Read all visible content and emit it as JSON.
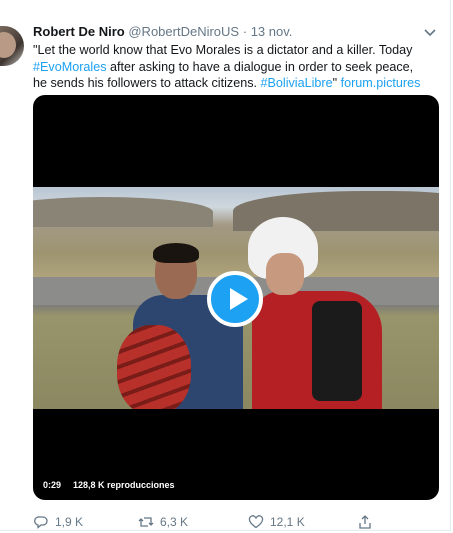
{
  "tweet": {
    "author_name": "Robert De Niro",
    "author_handle": "@RobertDeNiroUS",
    "separator": "·",
    "date": "13 nov.",
    "text_part1": "\"Let the world know that Evo Morales is a dictator and a killer. Today ",
    "hashtag1": "#EvoMorales",
    "text_part2": " after asking to have a dialogue in order to seek peace, he sends his followers to attack citizens. ",
    "hashtag2": "#BoliviaLibre",
    "text_part3": "\" ",
    "link": "forum.pictures"
  },
  "video": {
    "duration": "0:29",
    "views": "128,8 K reproducciones"
  },
  "actions": {
    "reply_count": "1,9 K",
    "retweet_count": "6,3 K",
    "like_count": "12,1 K"
  },
  "colors": {
    "accent": "#1da1f2",
    "secondary_text": "#657786"
  },
  "icons": [
    "chevron-down-icon",
    "play-icon",
    "reply-icon",
    "retweet-icon",
    "like-icon",
    "share-icon"
  ]
}
